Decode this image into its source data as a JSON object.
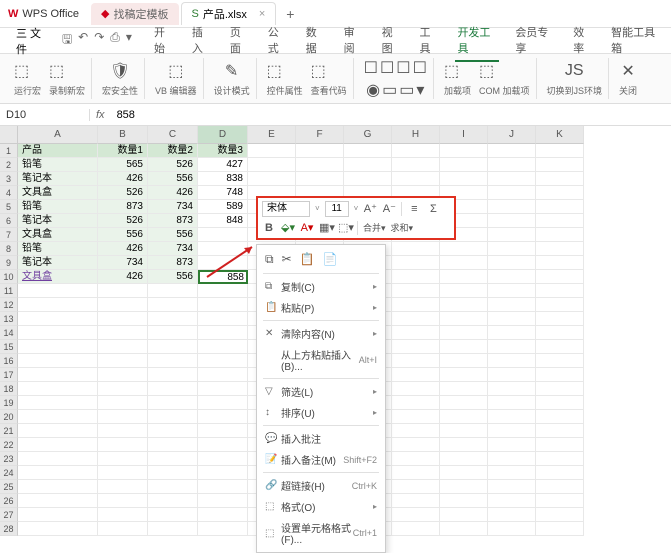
{
  "title_bar": {
    "app_logo": "W",
    "app_name": "WPS Office",
    "doc_tab": "找稿定模板",
    "active_tab": "产品.xlsx",
    "add": "+"
  },
  "menu": {
    "file": "三 文件",
    "tabs": [
      "开始",
      "插入",
      "页面",
      "公式",
      "数据",
      "审阅",
      "视图",
      "工具",
      "开发工具",
      "会员专享",
      "效率",
      "智能工具箱"
    ],
    "active_index": 8
  },
  "ribbon": {
    "g1a": "运行宏",
    "g1b": "录制新宏",
    "g2": "宏安全性",
    "g3": "VB 编辑器",
    "g4": "设计模式",
    "g5a": "控件属性",
    "g5b": "查看代码",
    "g6a": "加载项",
    "g6b": "COM 加载项",
    "g7": "切换到JS环境",
    "g8": "关闭"
  },
  "formula": {
    "name_box": "D10",
    "fx": "fx",
    "value": "858"
  },
  "cols": [
    "A",
    "B",
    "C",
    "D",
    "E",
    "F",
    "G",
    "H",
    "I",
    "J",
    "K"
  ],
  "headers": {
    "a": "产品",
    "b": "数量1",
    "c": "数量2",
    "d": "数量3"
  },
  "data": [
    {
      "a": "铅笔",
      "b": 565,
      "c": 526,
      "d": 427
    },
    {
      "a": "笔记本",
      "b": 426,
      "c": 556,
      "d": 838
    },
    {
      "a": "文具盒",
      "b": 526,
      "c": 426,
      "d": 748
    },
    {
      "a": "铅笔",
      "b": 873,
      "c": 734,
      "d": 589
    },
    {
      "a": "笔记本",
      "b": 526,
      "c": 873,
      "d": 848
    },
    {
      "a": "文具盒",
      "b": 556,
      "c": 556,
      "d": ""
    },
    {
      "a": "铅笔",
      "b": 426,
      "c": 734,
      "d": ""
    },
    {
      "a": "笔记本",
      "b": 734,
      "c": 873,
      "d": ""
    },
    {
      "a": "文具盒",
      "b": 426,
      "c": 556,
      "d": ""
    }
  ],
  "active_cell_value": "858",
  "mini": {
    "font": "宋体",
    "size": "11",
    "aplus": "A⁺",
    "aminus": "A⁻",
    "bold": "B",
    "merge": "合并▾",
    "sum": "求和▾"
  },
  "ctx": {
    "icons": {
      "copy": "⧉",
      "cut": "✂",
      "paste": "📋",
      "paste2": "📄"
    },
    "copy": "复制(C)",
    "paste_menu": "粘贴(P)",
    "clear": "清除内容(N)",
    "insert_copied": "从上方粘贴插入(B)...",
    "shortcut_insert": "Alt+I",
    "filter": "筛选(L)",
    "sort": "排序(U)",
    "insert_comment": "插入批注",
    "insert_note": "插入备注(M)",
    "shortcut_note": "Shift+F2",
    "hyperlink": "超链接(H)",
    "shortcut_link": "Ctrl+K",
    "format": "格式(O)",
    "define_name": "设置单元格格式(F)...",
    "shortcut_format": "Ctrl+1"
  }
}
